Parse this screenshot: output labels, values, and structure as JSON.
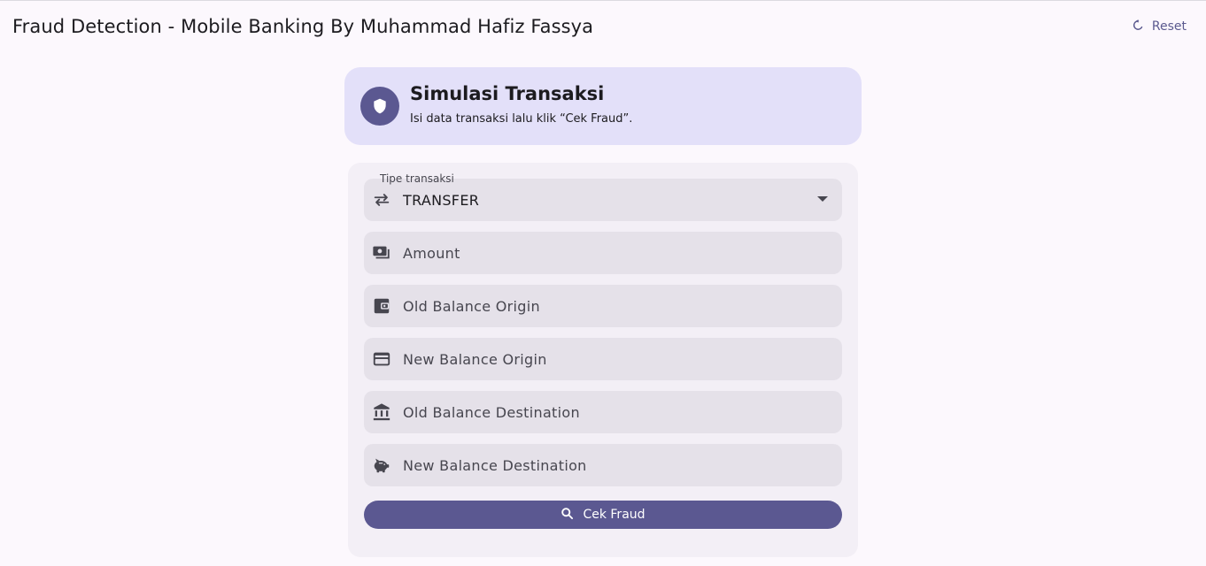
{
  "app": {
    "title": "Fraud Detection - Mobile Banking By Muhammad Hafiz Fassya",
    "reset_label": "Reset"
  },
  "header": {
    "title": "Simulasi Transaksi",
    "subtitle": "Isi data transaksi lalu klik “Cek Fraud”.",
    "icon": "shield-icon"
  },
  "form": {
    "type_field": {
      "label": "Tipe transaksi",
      "value": "TRANSFER",
      "icon": "swap-icon"
    },
    "fields": [
      {
        "placeholder": "Amount",
        "icon": "money-icon"
      },
      {
        "placeholder": "Old Balance Origin",
        "icon": "wallet-icon"
      },
      {
        "placeholder": "New Balance Origin",
        "icon": "card-icon"
      },
      {
        "placeholder": "Old Balance Destination",
        "icon": "bank-icon"
      },
      {
        "placeholder": "New Balance Destination",
        "icon": "piggy-bank-icon"
      }
    ],
    "submit_label": "Cek Fraud"
  },
  "colors": {
    "primary": "#5b5891",
    "header_bg": "#e3e0f9",
    "field_bg": "#e5e1e9",
    "page_bg": "#fcf8fd"
  }
}
